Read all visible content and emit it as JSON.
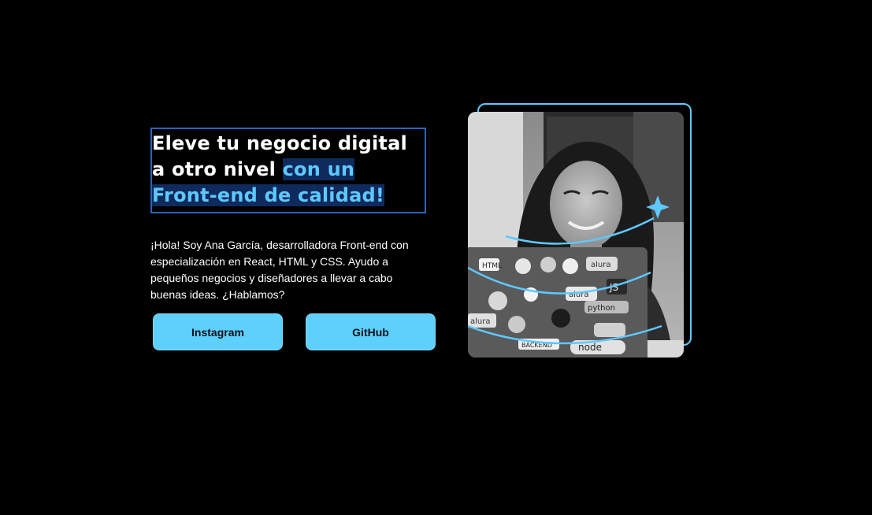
{
  "hero": {
    "title_plain": "Eleve tu negocio digital a otro nivel ",
    "title_highlight": "con un Front-end de calidad!",
    "description": "¡Hola! Soy Ana García, desarrolladora Front-end con especialización en React, HTML y CSS. Ayudo a pequeños negocios y diseñadores a llevar a cabo buenas ideas. ¿Hablamos?"
  },
  "buttons": {
    "instagram_label": "Instagram",
    "github_label": "GitHub"
  },
  "photo": {
    "sticker_texts": [
      "HTML",
      "alura",
      "JS",
      "alura",
      "python",
      "alura",
      "node",
      "BACKEND"
    ]
  },
  "colors": {
    "background": "#000000",
    "accent": "#5ec9ff",
    "highlight_bg": "#0f2a5c",
    "button_bg": "#5ed0fb",
    "frame_border": "#2e64b8"
  }
}
